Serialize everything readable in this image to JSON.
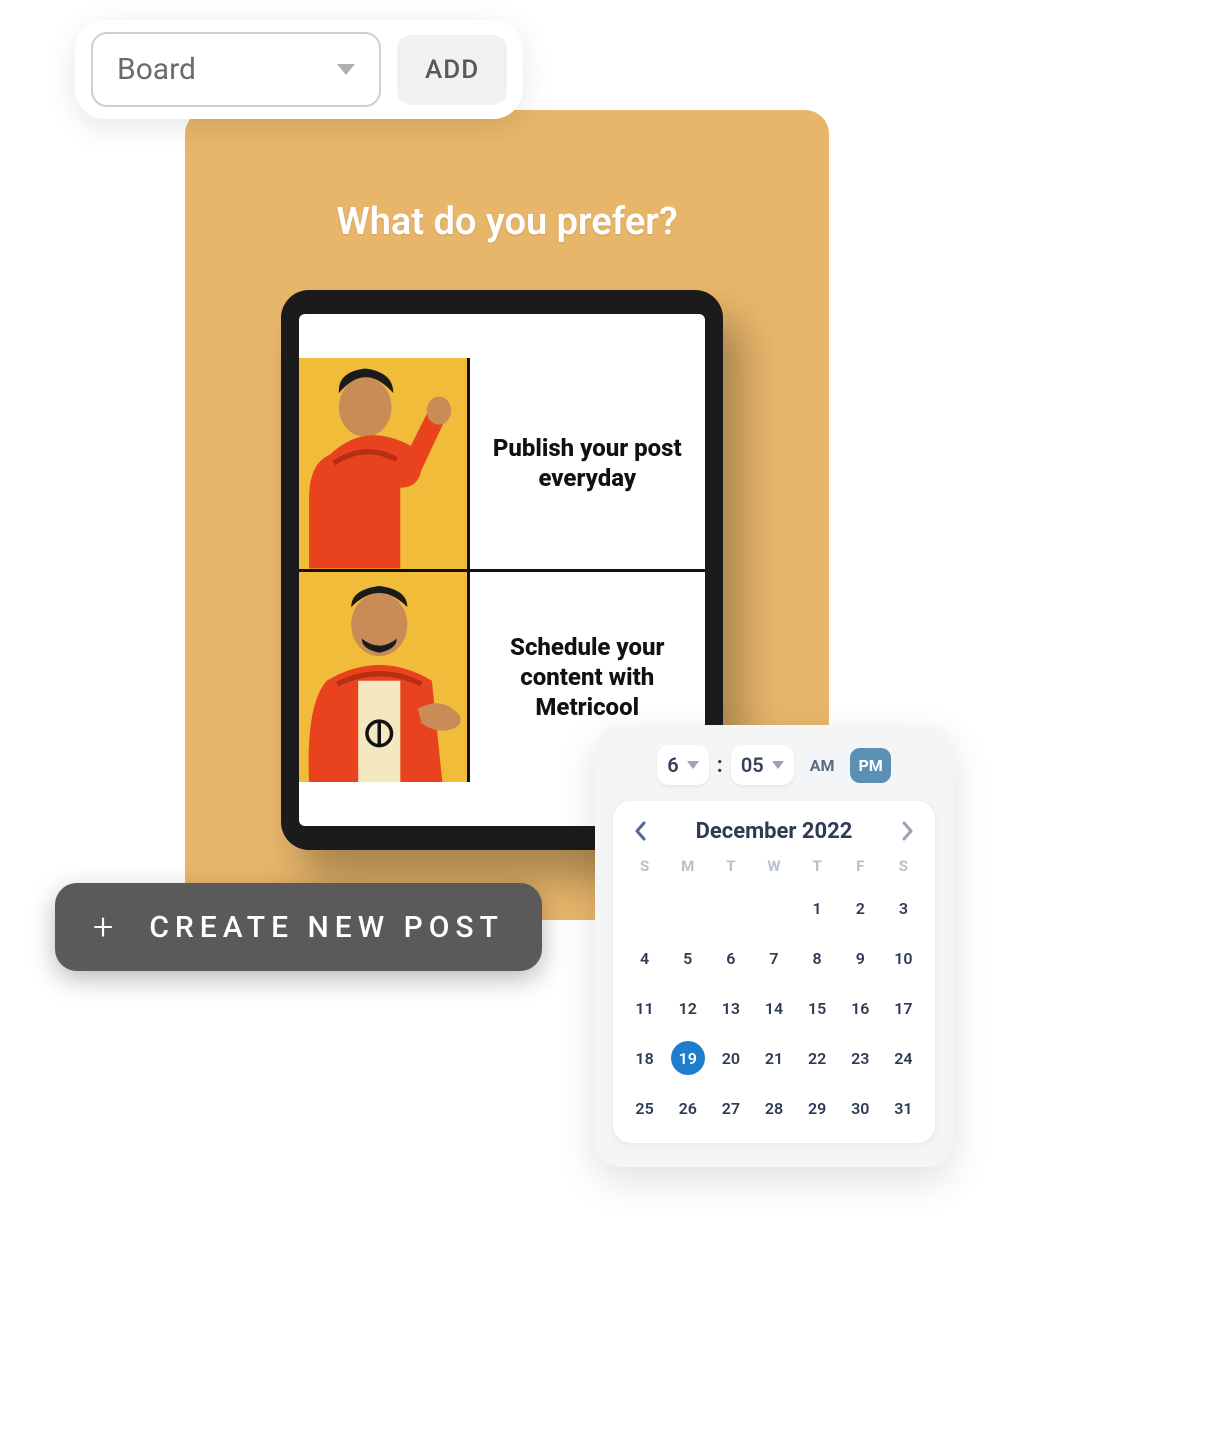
{
  "toolbar": {
    "select_label": "Board",
    "add_label": "ADD"
  },
  "post": {
    "title": "What do you prefer?",
    "meme_top_text": "Publish your post everyday",
    "meme_bottom_text": "Schedule your content with Metricool"
  },
  "create_button": {
    "label": "CREATE NEW POST"
  },
  "picker": {
    "hour": "6",
    "minute": "05",
    "am_label": "AM",
    "pm_label": "PM",
    "active_period": "PM",
    "month_label": "December 2022",
    "weekdays": [
      "S",
      "M",
      "T",
      "W",
      "T",
      "F",
      "S"
    ],
    "leading_blanks": 4,
    "days": [
      1,
      2,
      3,
      4,
      5,
      6,
      7,
      8,
      9,
      10,
      11,
      12,
      13,
      14,
      15,
      16,
      17,
      18,
      19,
      20,
      21,
      22,
      23,
      24,
      25,
      26,
      27,
      28,
      29,
      30,
      31
    ],
    "selected_day": 19
  }
}
